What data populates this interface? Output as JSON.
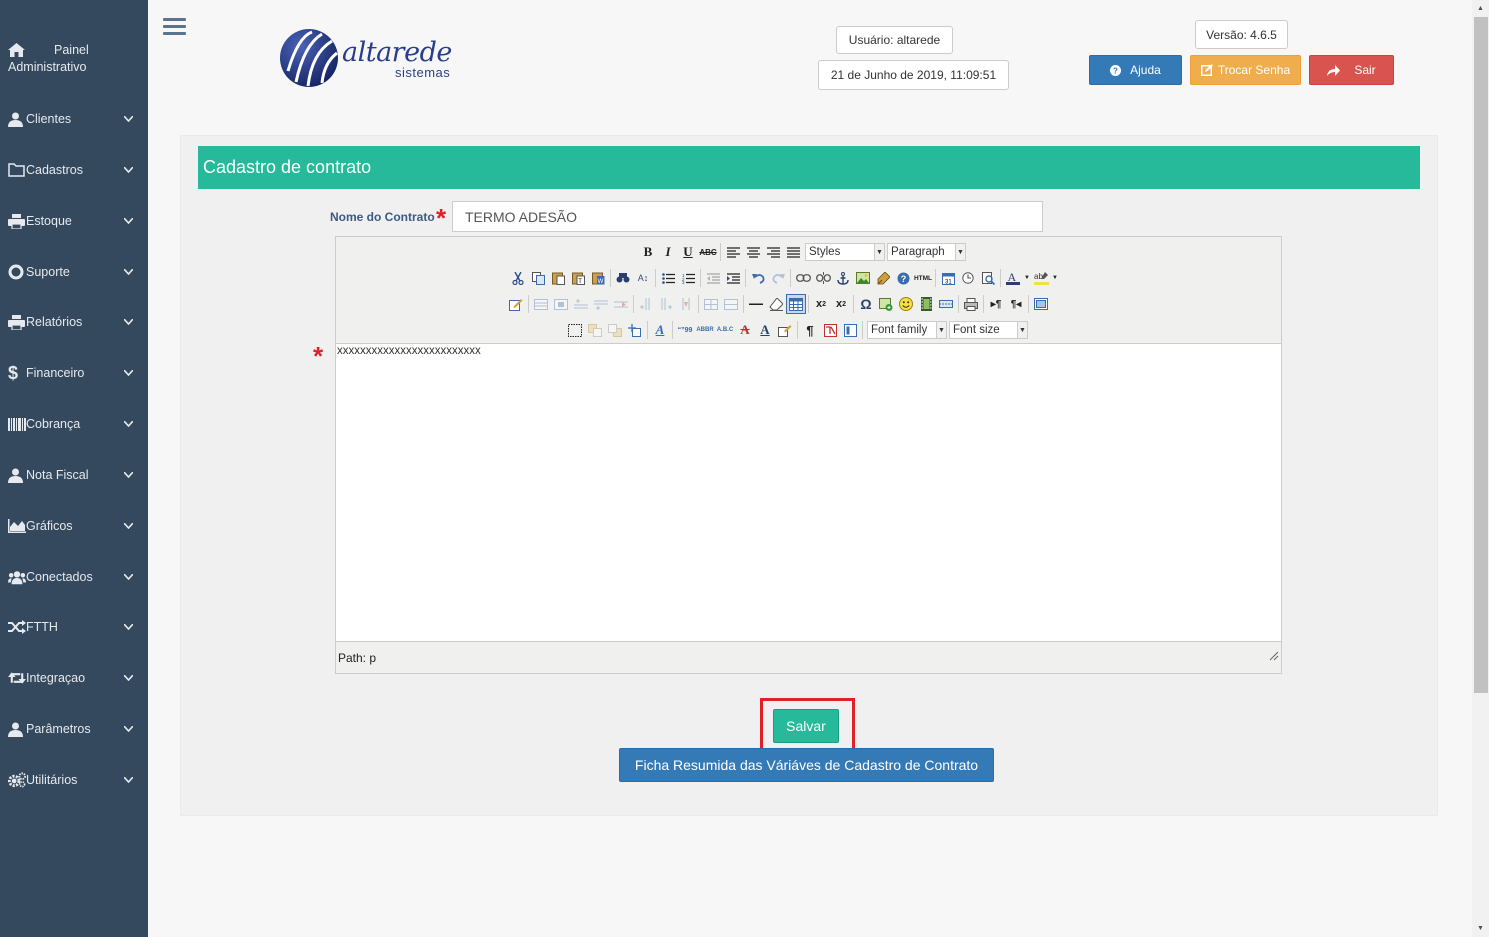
{
  "sidebar": {
    "brand": {
      "line1": "Painel",
      "line2": "Administrativo",
      "icon": "home-icon"
    },
    "items": [
      {
        "label": "Clientes",
        "icon": "user-icon"
      },
      {
        "label": "Cadastros",
        "icon": "folder-icon"
      },
      {
        "label": "Estoque",
        "icon": "print-icon"
      },
      {
        "label": "Suporte",
        "icon": "lifebuoy-icon"
      },
      {
        "label": "Relatórios",
        "icon": "print-icon"
      },
      {
        "label": "Financeiro",
        "icon": "dollar-icon"
      },
      {
        "label": "Cobrança",
        "icon": "barcode-icon"
      },
      {
        "label": "Nota Fiscal",
        "icon": "user-icon"
      },
      {
        "label": "Gráficos",
        "icon": "area-chart-icon"
      },
      {
        "label": "Conectados",
        "icon": "users-icon"
      },
      {
        "label": "FTTH",
        "icon": "random-icon"
      },
      {
        "label": "Integraçao",
        "icon": "retweet-icon"
      },
      {
        "label": "Parâmetros",
        "icon": "user-icon"
      },
      {
        "label": "Utilitários",
        "icon": "cogs-icon"
      }
    ]
  },
  "header": {
    "logo_word": "altarede",
    "logo_sub": "sistemas",
    "user": "Usuário: altarede",
    "datetime": "21 de Junho de 2019, 11:09:51",
    "version": "Versão: 4.6.5",
    "help_label": "Ajuda",
    "change_password_label": "Trocar Senha",
    "logout_label": "Sair",
    "colors": {
      "help": "#337ab7",
      "change_password": "#f0ad4e",
      "logout": "#d9534f"
    }
  },
  "form": {
    "title": "Cadastro de contrato",
    "contract_name_label": "Nome do Contrato",
    "contract_name_value": "TERMO ADESÃO",
    "editor": {
      "styles_select": "Styles",
      "format_select": "Paragraph",
      "font_family_select": "Font family",
      "font_size_select": "Font size",
      "content": "xxxxxxxxxxxxxxxxxxxxxxxxx",
      "path": "Path: p"
    },
    "save_label": "Salvar",
    "summary_label": "Ficha Resumida das Váriáves de Cadastro de Contrato",
    "colors": {
      "header": "#26b99a",
      "required": "#e0202a"
    }
  }
}
